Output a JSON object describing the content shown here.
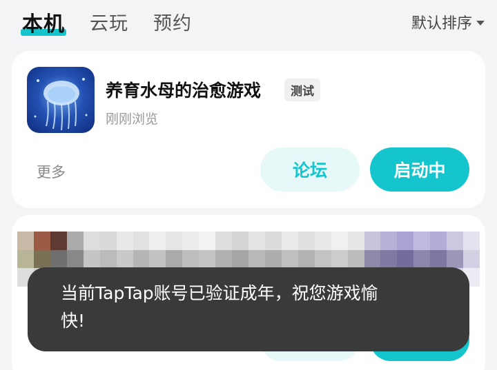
{
  "tabs": [
    {
      "label": "本机"
    },
    {
      "label": "云玩"
    },
    {
      "label": "预约"
    }
  ],
  "sort": {
    "label": "默认排序"
  },
  "card": {
    "title": "养育水母的治愈游戏",
    "badge": "测试",
    "subtitle": "刚刚浏览",
    "more_label": "更多",
    "forum_label": "论坛",
    "launch_label": "启动中"
  },
  "toast": {
    "line1": "当前TapTap账号已验证成年，祝您游戏愉",
    "line2": "快!"
  },
  "colors": {
    "accent": "#15c5ce",
    "accent_light": "#e7f8f8",
    "toast_bg": "#3a3a3a"
  }
}
